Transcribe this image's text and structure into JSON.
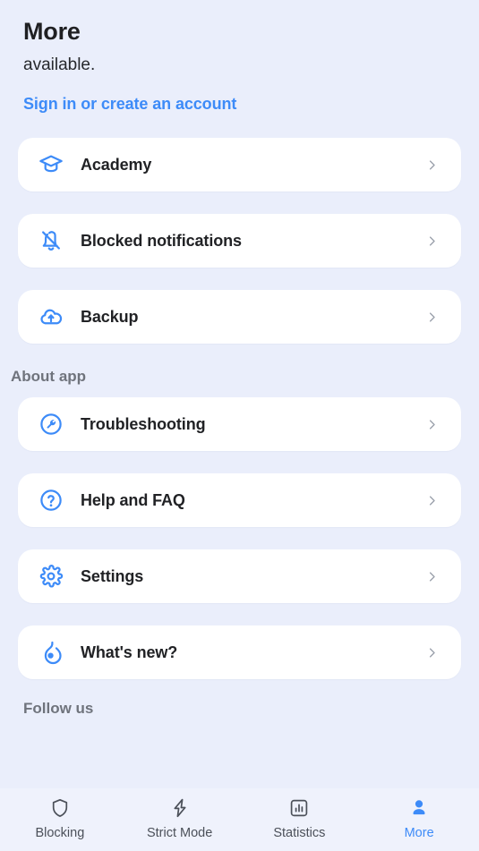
{
  "header": {
    "title": "More",
    "subtitle": "available.",
    "signin_link": "Sign in or create an account"
  },
  "colors": {
    "background": "#eaeefb",
    "card": "#ffffff",
    "accent": "#3d8bf8",
    "text": "#212225",
    "muted": "#6f737c",
    "chevron": "#9aa0ab",
    "nav_inactive": "#4b5059"
  },
  "main": {
    "primary_items": [
      {
        "label": "Academy",
        "icon": "graduation-cap-icon"
      },
      {
        "label": "Blocked notifications",
        "icon": "bell-off-icon"
      },
      {
        "label": "Backup",
        "icon": "cloud-upload-icon"
      }
    ],
    "about_section": {
      "label": "About app",
      "items": [
        {
          "label": "Troubleshooting",
          "icon": "wrench-circle-icon"
        },
        {
          "label": "Help and FAQ",
          "icon": "question-circle-icon"
        },
        {
          "label": "Settings",
          "icon": "gear-icon"
        },
        {
          "label": "What's new?",
          "icon": "flame-icon"
        }
      ]
    },
    "follow_section": {
      "label": "Follow us"
    },
    "chevron_glyph": "chevron-right-icon"
  },
  "bottom_nav": {
    "items": [
      {
        "label": "Blocking",
        "icon": "shield-icon",
        "active": false
      },
      {
        "label": "Strict Mode",
        "icon": "lightning-bolt-icon",
        "active": false
      },
      {
        "label": "Statistics",
        "icon": "bar-chart-icon",
        "active": false
      },
      {
        "label": "More",
        "icon": "person-icon",
        "active": true
      }
    ]
  }
}
